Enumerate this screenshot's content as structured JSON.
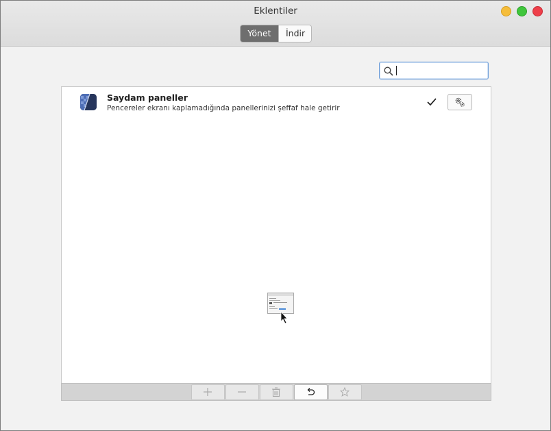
{
  "window": {
    "title": "Eklentiler"
  },
  "switcher": {
    "manage_label": "Yönet",
    "download_label": "İndir"
  },
  "search": {
    "value": ""
  },
  "extensions": [
    {
      "name": "Saydam paneller",
      "description": "Pencereler ekranı kaplamadığında panellerinizi şeffaf hale getirir",
      "enabled": true,
      "icon": "transparent-panels-icon"
    }
  ],
  "toolbar": {
    "buttons": [
      {
        "icon": "plus-icon",
        "enabled": false
      },
      {
        "icon": "minus-icon",
        "enabled": false
      },
      {
        "icon": "trash-icon",
        "enabled": false
      },
      {
        "icon": "undo-icon",
        "enabled": true
      },
      {
        "icon": "star-icon",
        "enabled": false
      }
    ]
  },
  "colors": {
    "accent_active_segment": "#6e6e6e",
    "search_focus": "#6e9ed8",
    "close": "#ee3f4a",
    "minimize": "#f5bd3b",
    "maximize": "#40c63c"
  }
}
